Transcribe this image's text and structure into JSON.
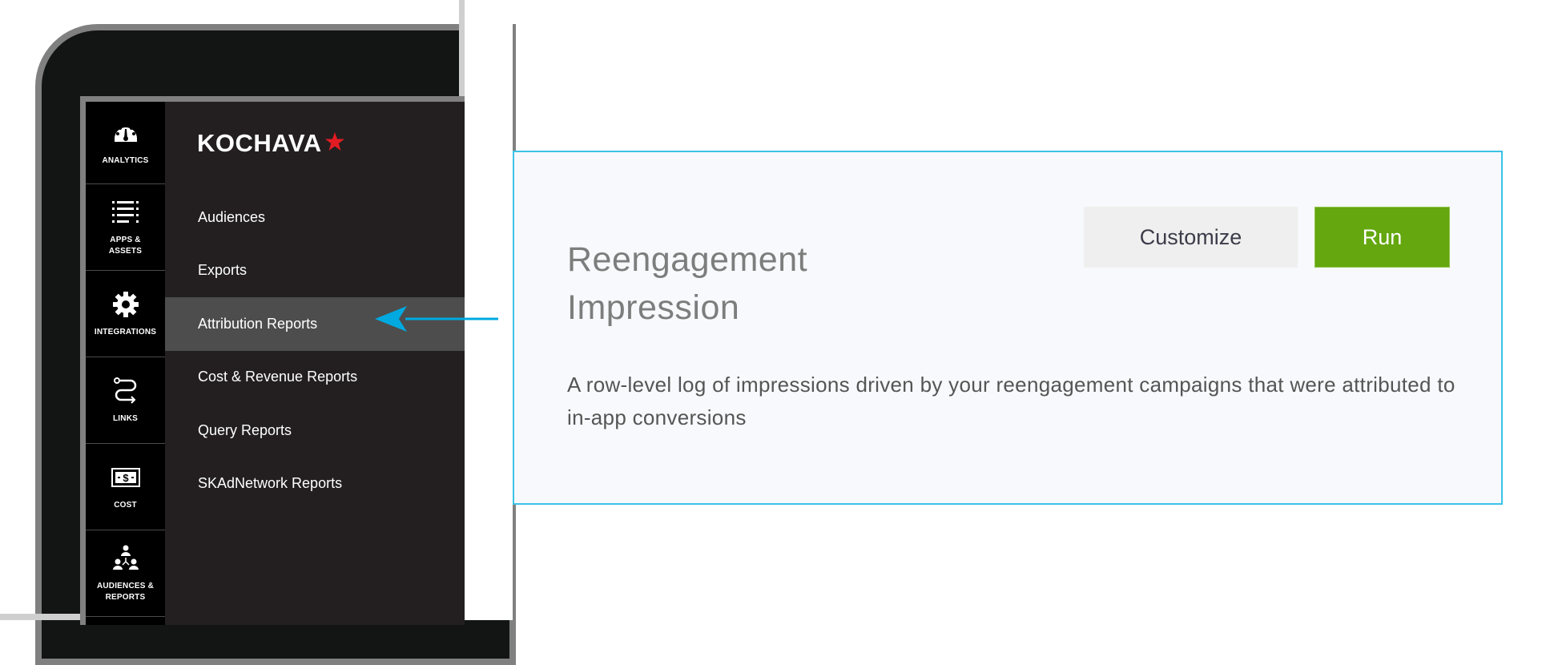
{
  "brand": {
    "name": "KOCHAVA",
    "star_color": "#e31b23"
  },
  "rail": {
    "items": [
      {
        "label": "ANALYTICS",
        "icon": "dashboard-gauge-icon"
      },
      {
        "label": "APPS &\nASSETS",
        "icon": "list-icon"
      },
      {
        "label": "INTEGRATIONS",
        "icon": "gear-icon"
      },
      {
        "label": "LINKS",
        "icon": "link-path-icon"
      },
      {
        "label": "COST",
        "icon": "dollar-bill-icon"
      },
      {
        "label": "AUDIENCES &\nREPORTS",
        "icon": "org-chart-icon"
      }
    ]
  },
  "submenu": {
    "items": [
      {
        "label": "Audiences",
        "active": false
      },
      {
        "label": "Exports",
        "active": false
      },
      {
        "label": "Attribution Reports",
        "active": true
      },
      {
        "label": "Cost & Revenue Reports",
        "active": false
      },
      {
        "label": "Query Reports",
        "active": false
      },
      {
        "label": "SKAdNetwork Reports",
        "active": false
      }
    ]
  },
  "callout": {
    "arrow_color": "#00a9e0"
  },
  "report_card": {
    "title": "Reengagement Impression",
    "description": "A row-level log of impressions driven by your reengagement campaigns that were attributed to in-app conversions",
    "customize_label": "Customize",
    "run_label": "Run",
    "border_color": "#3cc3e8",
    "run_color": "#64a70f"
  }
}
